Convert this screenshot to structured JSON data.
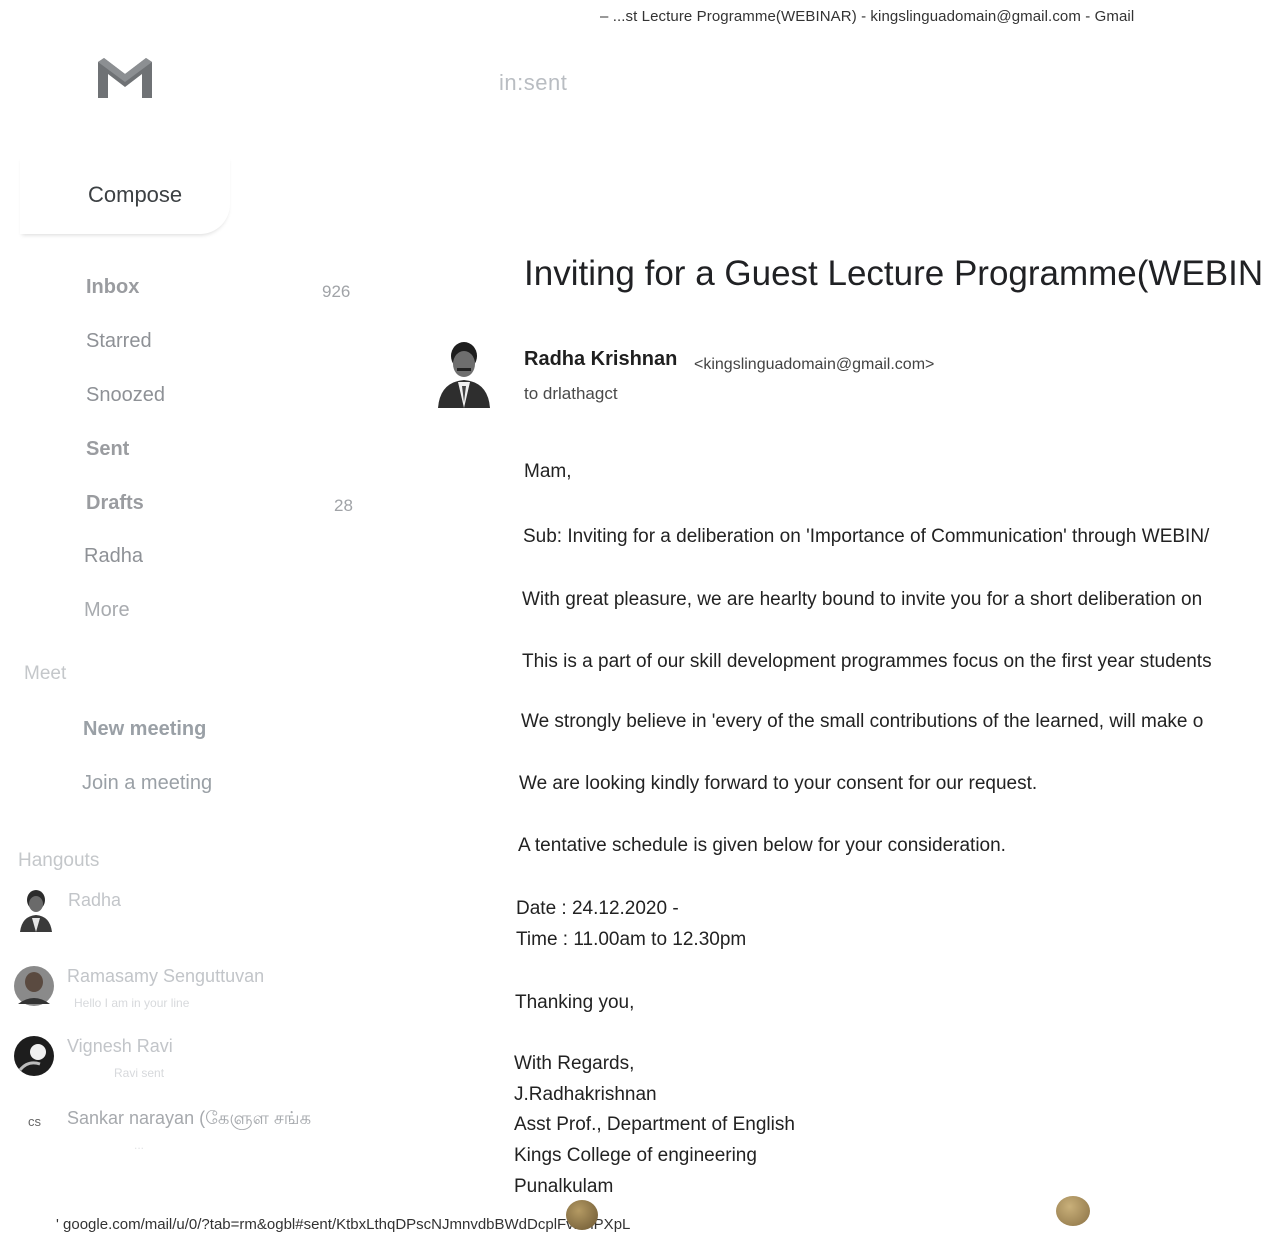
{
  "window_title": "–   ...st Lecture Programme(WEBINAR) - kingslinguadomain@gmail.com - Gmail",
  "search": {
    "text": "in:sent"
  },
  "compose": {
    "label": "Compose"
  },
  "sidebar": {
    "items": [
      {
        "label": "Inbox",
        "count": "926"
      },
      {
        "label": "Starred",
        "count": ""
      },
      {
        "label": "Snoozed",
        "count": ""
      },
      {
        "label": "Sent",
        "count": ""
      },
      {
        "label": "Drafts",
        "count": "28"
      },
      {
        "label": "Radha",
        "count": ""
      },
      {
        "label": "More",
        "count": ""
      }
    ]
  },
  "meet": {
    "heading": "Meet",
    "items": [
      {
        "label": "New meeting"
      },
      {
        "label": "Join a meeting"
      }
    ]
  },
  "hangouts": {
    "heading": "Hangouts",
    "contacts": [
      {
        "name": "Radha",
        "status": ""
      },
      {
        "name": "Ramasamy Senguttuvan",
        "status": "Hello I am in your line"
      },
      {
        "name": "Vignesh Ravi",
        "status": "Ravi sent"
      },
      {
        "name": "Sankar narayan (கேளுள சங்க",
        "status": "...",
        "initials": "cs"
      }
    ]
  },
  "message": {
    "subject": "Inviting for a Guest Lecture Programme(WEBIN",
    "sender_name": "Radha Krishnan",
    "sender_email": "<kingslinguadomain@gmail.com>",
    "recipient": "to drlathagct",
    "greeting": "Mam,",
    "paragraphs": [
      "Sub: Inviting for a deliberation on 'Importance of Communication' through WEBIN/",
      "With great pleasure, we are hearlty bound to invite you for a short deliberation on",
      "This is a part of our skill development programmes focus on the first year students",
      "We strongly believe in 'every of the small contributions of the learned, will make  o",
      "We are looking kindly forward to your consent for our request.",
      "A tentative schedule is given below for your consideration."
    ],
    "date_line": "Date : 24.12.2020 -",
    "time_line": "Time : 11.00am to 12.30pm",
    "thanks": "Thanking you,",
    "signature": [
      "With Regards,",
      "J.Radhakrishnan",
      "Asst Prof., Department of English",
      "Kings College of engineering",
      "Punalkulam"
    ]
  },
  "status_url": "' google.com/mail/u/0/?tab=rm&ogbl#sent/KtbxLthqDPscNJmnvdbBWdDcplFvkmPXpL",
  "colors": {
    "gmail_logo_gray": "#6f7275",
    "text_faded": "#8e9196"
  }
}
